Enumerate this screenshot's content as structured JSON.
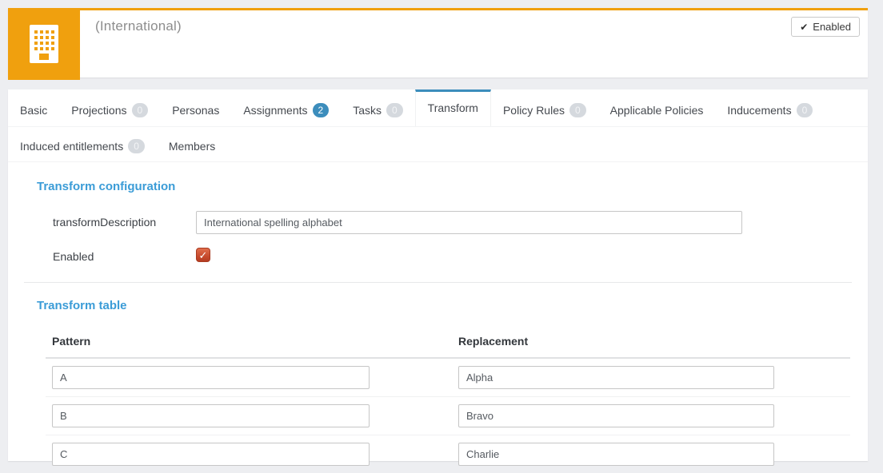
{
  "header": {
    "title": "(International)",
    "status_badge": {
      "label": "Enabled"
    }
  },
  "tabs": {
    "row1": [
      {
        "label": "Basic"
      },
      {
        "label": "Projections",
        "badge": "0",
        "badge_style": "gray"
      },
      {
        "label": "Personas"
      },
      {
        "label": "Assignments",
        "badge": "2",
        "badge_style": "blue"
      },
      {
        "label": "Tasks",
        "badge": "0",
        "badge_style": "gray"
      },
      {
        "label": "Transform",
        "active": true
      },
      {
        "label": "Policy Rules",
        "badge": "0",
        "badge_style": "gray"
      },
      {
        "label": "Applicable Policies"
      },
      {
        "label": "Inducements",
        "badge": "0",
        "badge_style": "gray"
      }
    ],
    "row2": [
      {
        "label": "Induced entitlements",
        "badge": "0",
        "badge_style": "gray"
      },
      {
        "label": "Members"
      }
    ]
  },
  "transform_configuration": {
    "heading": "Transform configuration",
    "description_label": "transformDescription",
    "description_value": "International spelling alphabet",
    "enabled_label": "Enabled",
    "enabled_checked": true
  },
  "transform_table": {
    "heading": "Transform table",
    "columns": [
      "Pattern",
      "Replacement"
    ],
    "rows": [
      {
        "pattern": "A",
        "replacement": "Alpha"
      },
      {
        "pattern": "B",
        "replacement": "Bravo"
      },
      {
        "pattern": "C",
        "replacement": "Charlie"
      }
    ]
  },
  "colors": {
    "accent_orange": "#f0a00e",
    "tab_active_blue": "#3c8dbc",
    "heading_blue": "#3b9cd7",
    "badge_blue": "#3c8dbc",
    "badge_gray": "#d5d9de",
    "checkbox_red": "#c74b2e",
    "page_background": "#edeef1"
  }
}
